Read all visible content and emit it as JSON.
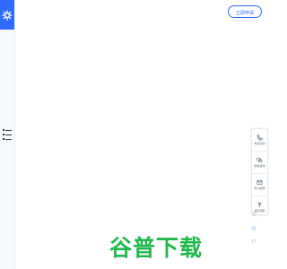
{
  "header": {
    "cta_label": "立即申请"
  },
  "toolbar": {
    "items": [
      {
        "icon": "phone-icon",
        "label": "电话咨询"
      },
      {
        "icon": "wechat-icon",
        "label": "微信咨询"
      },
      {
        "icon": "mail-icon",
        "label": "电子邮箱"
      },
      {
        "icon": "back-to-top-icon",
        "label": "返回顶部"
      }
    ]
  },
  "side_mini": {
    "top": "卫",
    "middle": "日",
    "bottom": "口"
  },
  "watermark": {
    "text": "谷普下载"
  },
  "colors": {
    "brand_blue": "#2f6bff",
    "watermark_green": "#20b84b"
  }
}
